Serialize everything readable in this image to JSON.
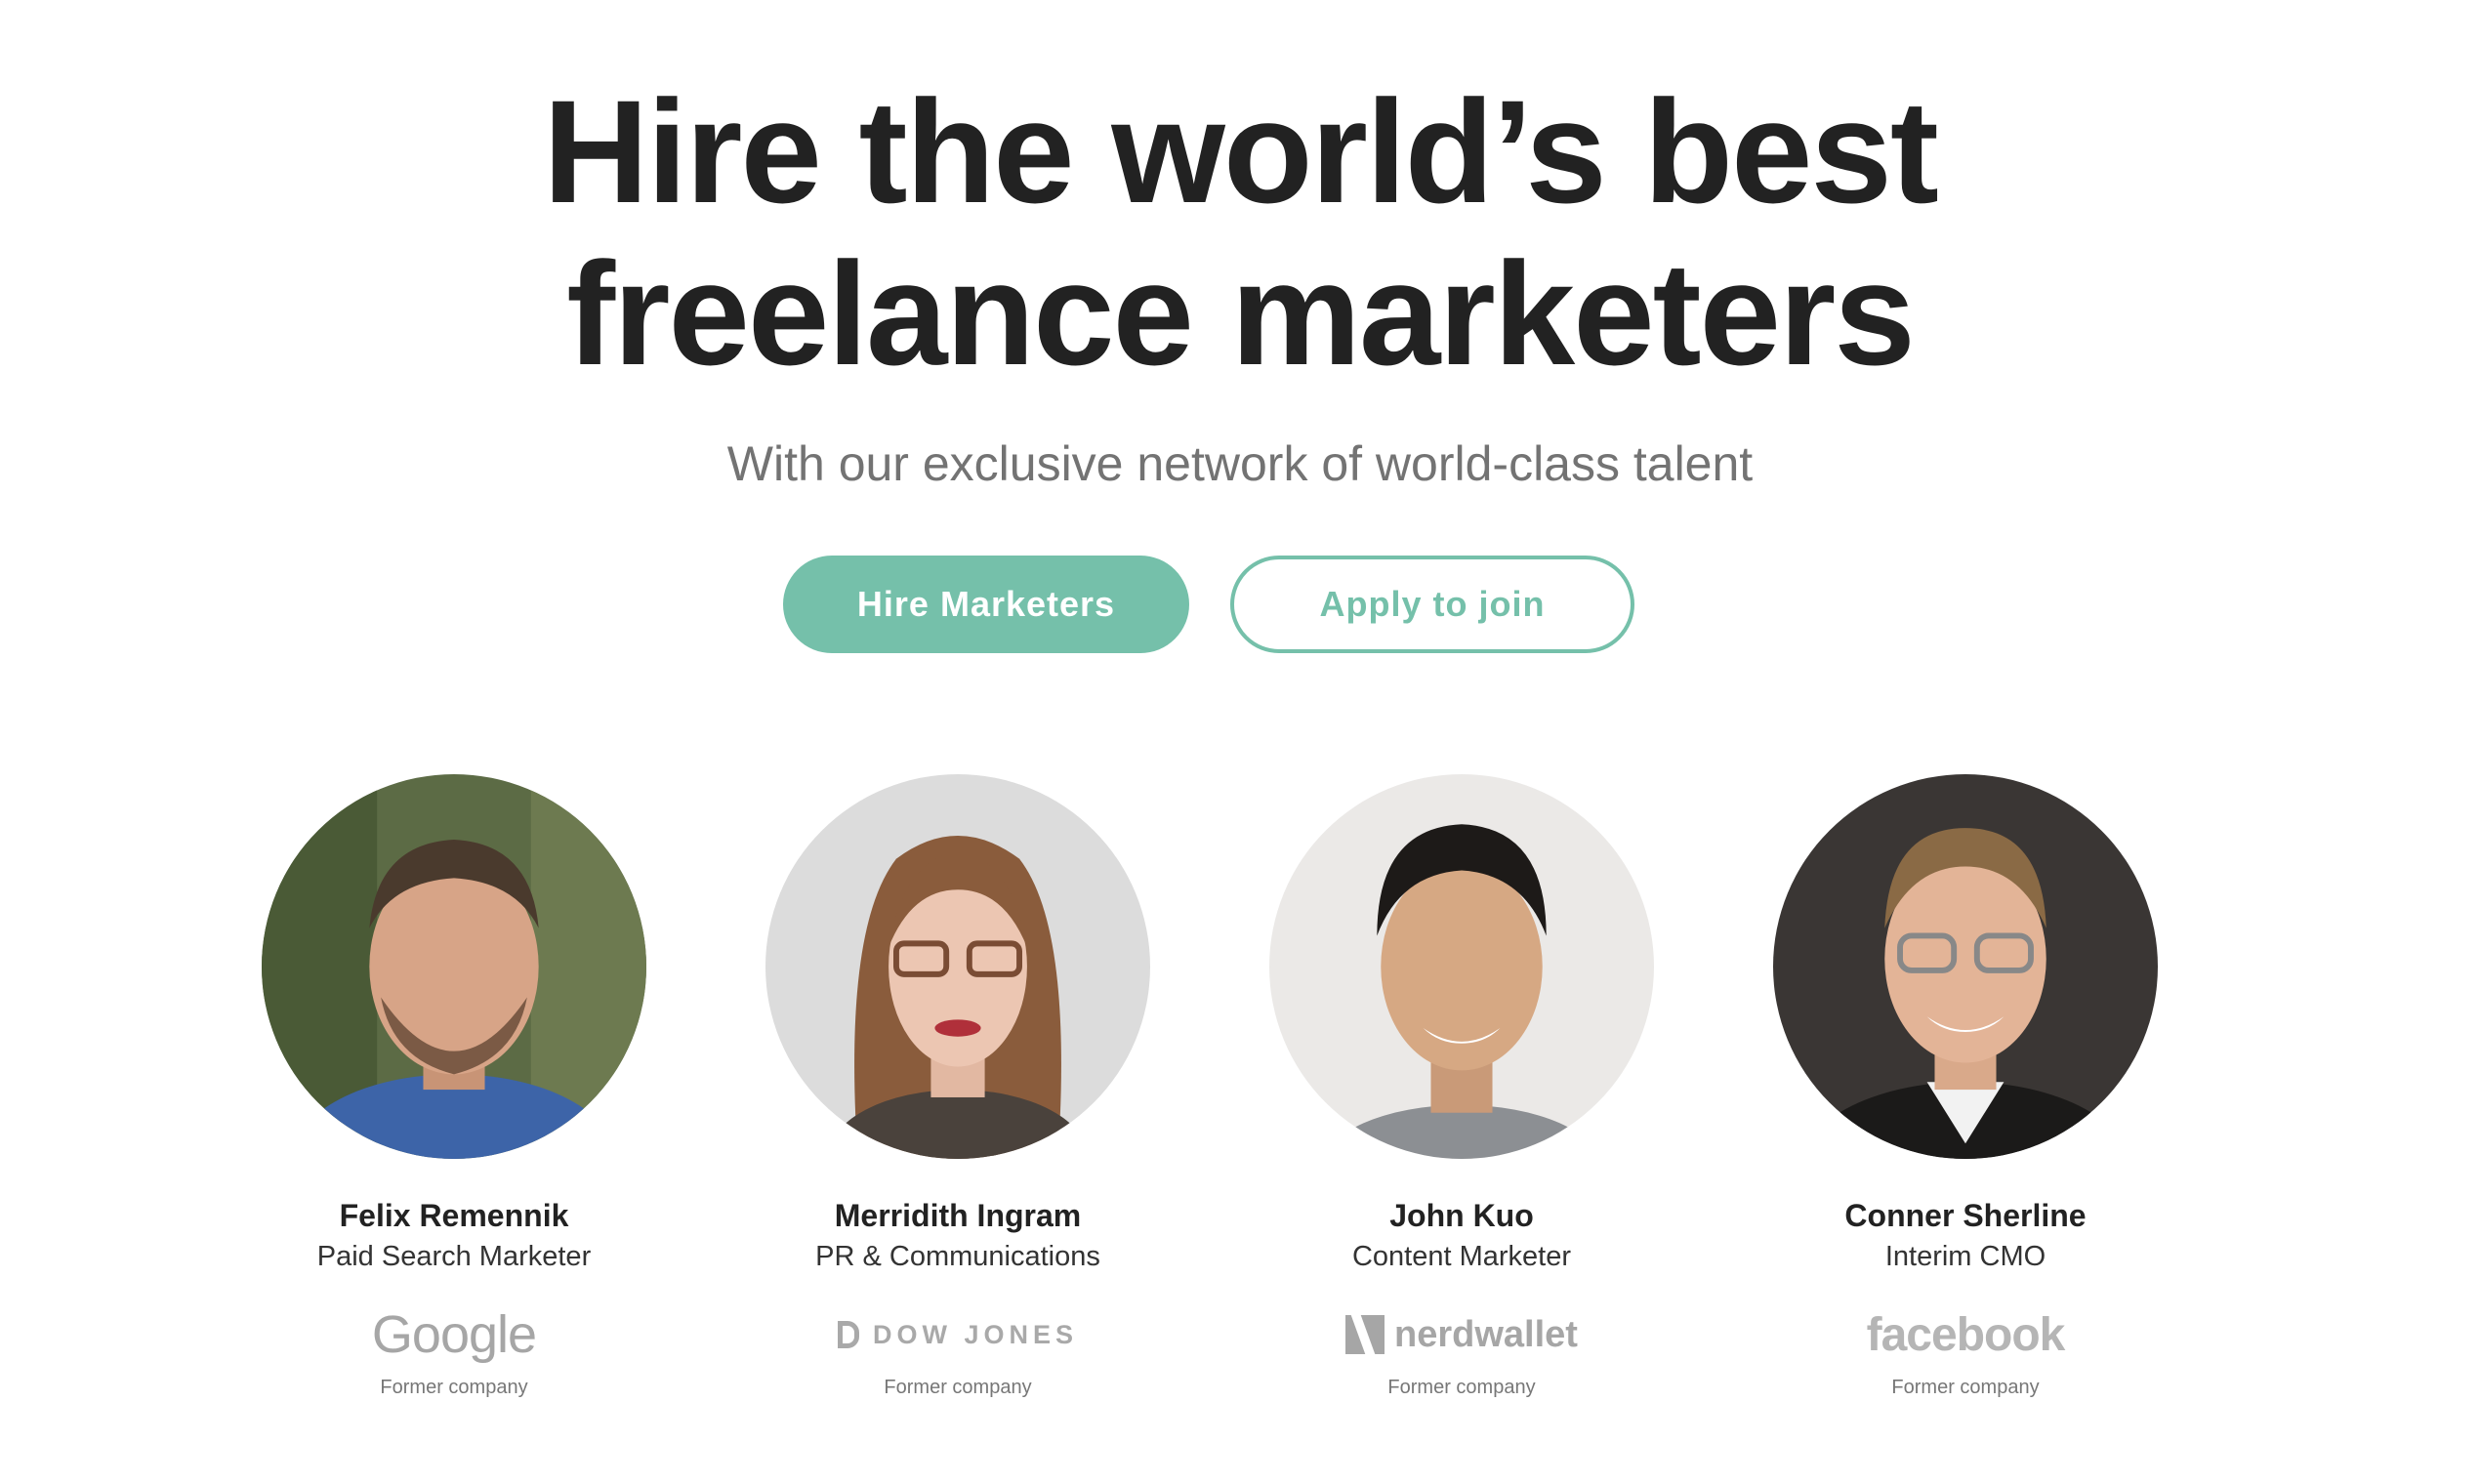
{
  "hero": {
    "headline_line1": "Hire the world’s best",
    "headline_line2": "freelance marketers",
    "subheadline": "With our exclusive network of world-class talent"
  },
  "actions": {
    "primary_label": "Hire Marketers",
    "secondary_label": "Apply to join"
  },
  "colors": {
    "accent": "#75c0aa",
    "headline": "#222222",
    "subheadline": "#737373"
  },
  "talent": [
    {
      "name": "Felix Remennik",
      "role": "Paid Search Marketer",
      "company": "Google",
      "caption": "Former company"
    },
    {
      "name": "Merridith Ingram",
      "role": "PR & Communications",
      "company": "DOW JONES",
      "caption": "Former company"
    },
    {
      "name": "John Kuo",
      "role": "Content Marketer",
      "company": "nerdwallet",
      "caption": "Former company"
    },
    {
      "name": "Conner Sherline",
      "role": "Interim CMO",
      "company": "facebook",
      "caption": "Former company"
    }
  ]
}
